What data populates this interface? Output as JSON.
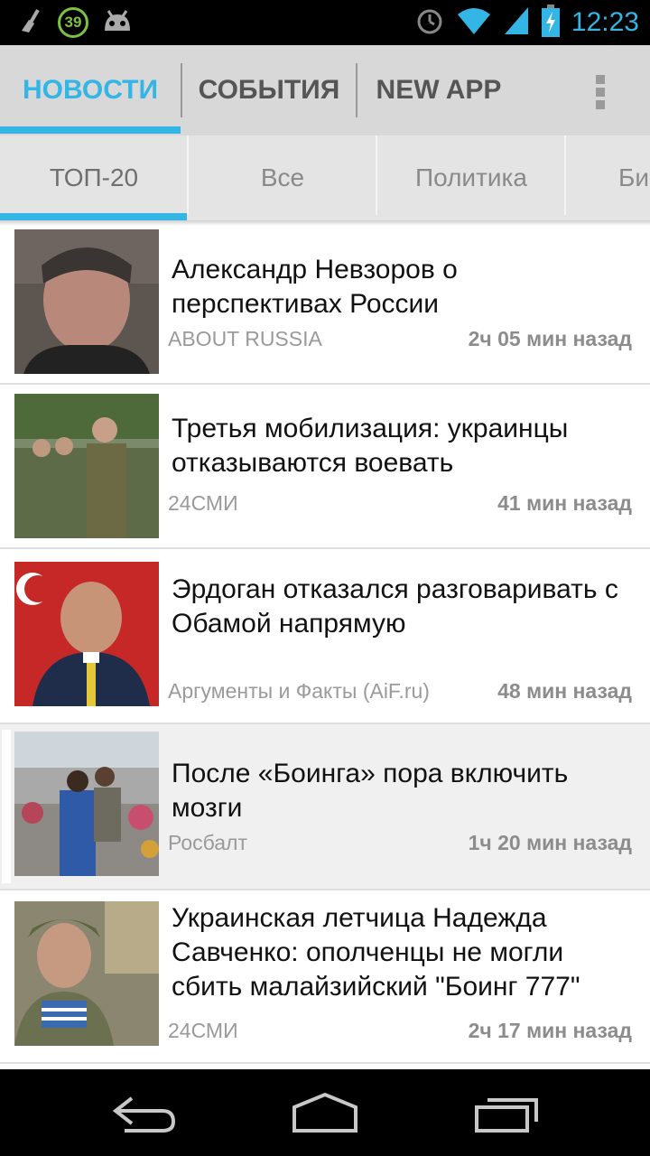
{
  "status_bar": {
    "notification_count": "39",
    "time": "12:23",
    "icons": [
      "cleaner-icon",
      "notification-badge-icon",
      "android-icon",
      "alarm-icon",
      "wifi-icon",
      "signal-icon",
      "battery-charging-icon"
    ]
  },
  "top_tabs": [
    {
      "label": "НОВОСТИ",
      "active": true
    },
    {
      "label": "СОБЫТИЯ",
      "active": false
    },
    {
      "label": "NEW APP",
      "active": false
    }
  ],
  "sub_tabs": [
    {
      "label": "ТОП-20",
      "active": true
    },
    {
      "label": "Все",
      "active": false
    },
    {
      "label": "Политика",
      "active": false
    },
    {
      "label": "Би",
      "active": false
    }
  ],
  "news": [
    {
      "title": "Александр Невзоров о перспективах России",
      "source": "ABOUT RUSSIA",
      "time": "2ч 05 мин назад"
    },
    {
      "title": "Третья мобилизация: украинцы отказываются воевать",
      "source": "24СМИ",
      "time": "41 мин назад"
    },
    {
      "title": "Эрдоган отказался разговаривать с Обамой напрямую",
      "source": "Аргументы и Факты (AiF.ru)",
      "time": "48 мин назад"
    },
    {
      "title": "После «Боинга» пора включить мозги",
      "source": "Росбалт",
      "time": "1ч 20 мин назад"
    },
    {
      "title": "Украинская летчица Надежда Савченко: ополченцы не могли сбить малайзийский \"Боинг 777\"",
      "source": "24СМИ",
      "time": "2ч 17 мин назад"
    }
  ],
  "colors": {
    "accent": "#33b5e5",
    "tab_bar": "#d8d8d8",
    "subtab_bar": "#e4e4e4"
  }
}
